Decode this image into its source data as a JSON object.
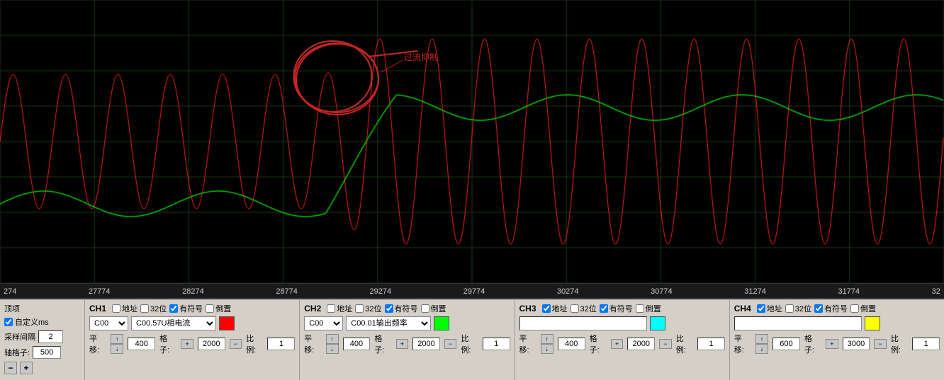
{
  "chart": {
    "background": "#000000",
    "grid_color": "#1a3a1a",
    "annotation_label": "过流抑制",
    "annotation_color": "#cc2222"
  },
  "x_axis": {
    "labels": [
      "274",
      "27774",
      "28274",
      "28774",
      "29274",
      "29774",
      "30274",
      "30774",
      "31274",
      "31774",
      "32"
    ]
  },
  "controls": {
    "left": {
      "section_label": "顶项",
      "custom_ms_checked": true,
      "custom_ms_label": "自定义ms",
      "sample_interval_label": "采样间隔",
      "sample_interval_value": "2",
      "axis_grid_label": "轴格子:",
      "axis_grid_value": "500",
      "minus_btn": "−",
      "plus_btn": "+"
    },
    "ch1": {
      "label": "CH1",
      "addr_checked": false,
      "addr_label": "地址",
      "bit32_checked": false,
      "bit32_label": "32位",
      "signed_checked": true,
      "signed_label": "有符号",
      "invert_checked": false,
      "invert_label": "倒置",
      "device_options": [
        "C00"
      ],
      "device_selected": "C00",
      "signal_options": [
        "C00.57U相电流"
      ],
      "signal_selected": "C00.57U相电流",
      "color": "red",
      "offset_label": "平移:",
      "offset_up": "↑",
      "offset_value": "400",
      "offset_down": "↓",
      "grid_label": "格子:",
      "grid_plus": "+",
      "grid_value": "2000",
      "grid_minus": "−",
      "scale_label": "比例:",
      "scale_value": "1"
    },
    "ch2": {
      "label": "CH2",
      "addr_checked": false,
      "addr_label": "地址",
      "bit32_checked": false,
      "bit32_label": "32位",
      "signed_checked": true,
      "signed_label": "有符号",
      "invert_checked": false,
      "invert_label": "倒置",
      "device_options": [
        "C00"
      ],
      "device_selected": "C00",
      "signal_options": [
        "C00.01输出频率"
      ],
      "signal_selected": "C00.01输出频率",
      "color": "green",
      "offset_label": "平移:",
      "offset_up": "↑",
      "offset_value": "400",
      "offset_down": "↓",
      "grid_label": "格子:",
      "grid_plus": "+",
      "grid_value": "2000",
      "grid_minus": "−",
      "scale_label": "比例:",
      "scale_value": "1"
    },
    "ch3": {
      "label": "CH3",
      "addr_checked": true,
      "addr_label": "地址",
      "bit32_checked": false,
      "bit32_label": "32位",
      "signed_checked": true,
      "signed_label": "有符号",
      "invert_checked": false,
      "invert_label": "倒置",
      "device_options": [
        ""
      ],
      "device_selected": "",
      "signal_options": [
        ""
      ],
      "signal_selected": "",
      "color": "cyan",
      "offset_label": "平移:",
      "offset_up": "↑",
      "offset_value": "400",
      "offset_down": "↓",
      "grid_label": "格子:",
      "grid_plus": "+",
      "grid_value": "2000",
      "grid_minus": "−",
      "scale_label": "比例:",
      "scale_value": "1"
    },
    "ch4": {
      "label": "CH4",
      "addr_checked": true,
      "addr_label": "地址",
      "bit32_checked": false,
      "bit32_label": "32位",
      "signed_checked": true,
      "signed_label": "有符号",
      "invert_checked": false,
      "invert_label": "倒置",
      "device_options": [
        ""
      ],
      "device_selected": "",
      "signal_options": [
        ""
      ],
      "signal_selected": "",
      "color": "yellow",
      "offset_label": "平移:",
      "offset_up": "↑",
      "offset_value": "600",
      "offset_down": "↓",
      "grid_label": "格子:",
      "grid_plus": "+",
      "grid_value": "3000",
      "grid_minus": "−",
      "scale_label": "比例:",
      "scale_value": "1"
    }
  }
}
